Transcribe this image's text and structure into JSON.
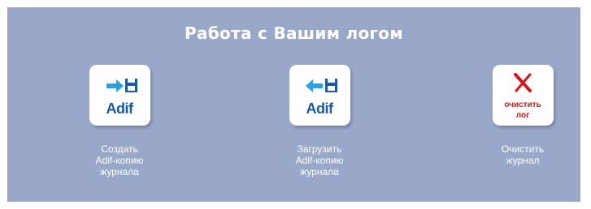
{
  "panel": {
    "title": "Работа с Вашим логом",
    "background": "#99a7c9"
  },
  "actions": [
    {
      "icon": "export-adif-icon",
      "icon_text": "Adif",
      "label_lines": [
        "Создать",
        "Adif-копию",
        "журнала"
      ]
    },
    {
      "icon": "import-adif-icon",
      "icon_text": "Adif",
      "label_lines": [
        "Загрузить",
        "Adif-копию",
        "журнала"
      ]
    },
    {
      "icon": "clear-log-icon",
      "icon_text_lines": [
        "очистить",
        "лог"
      ],
      "label_lines": [
        "Очистить",
        "журнал"
      ]
    }
  ],
  "colors": {
    "icon_blue": "#1a5a9e",
    "arrow_blue": "#29a3e0",
    "clear_red": "#d01919"
  }
}
